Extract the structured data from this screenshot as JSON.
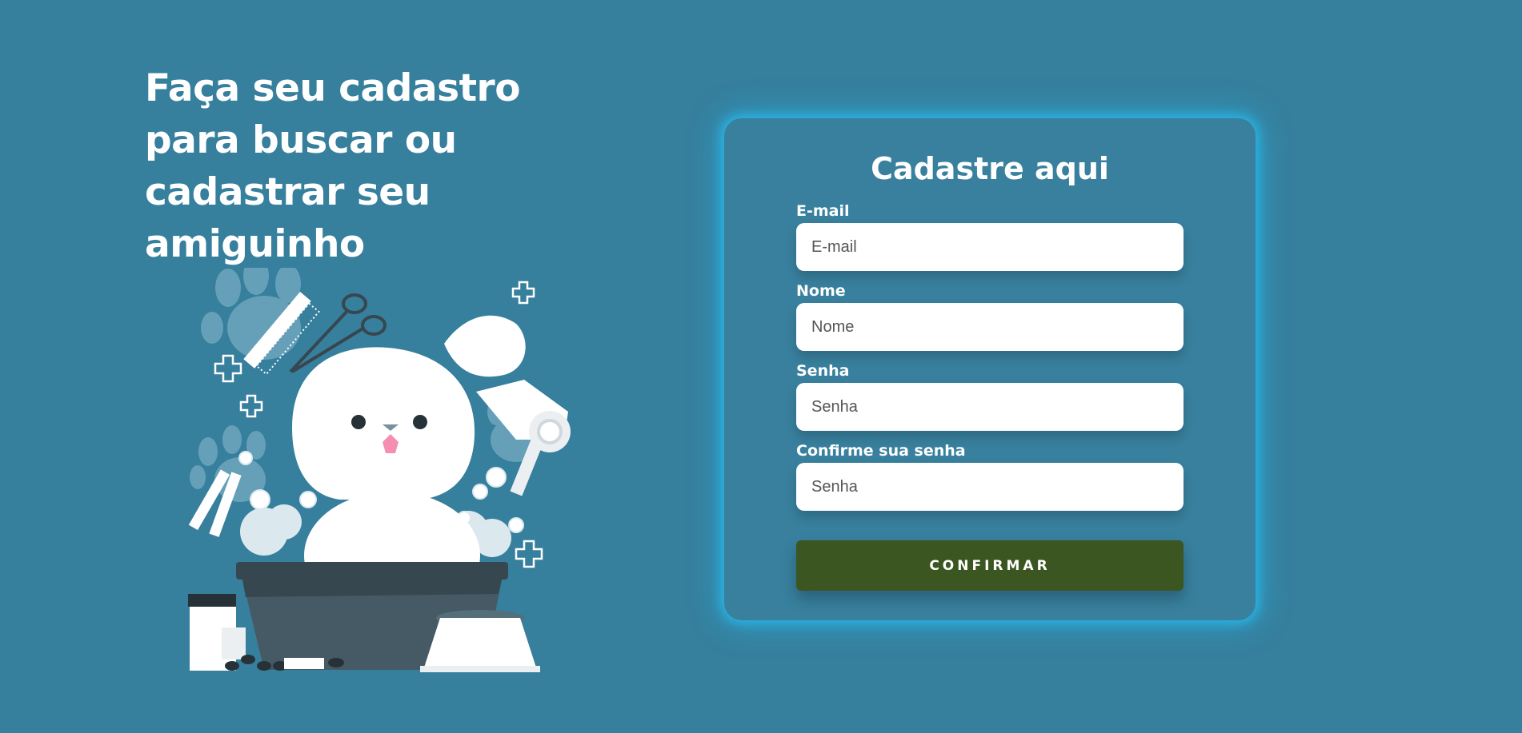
{
  "hero": {
    "headline": "Faça seu cadastro para buscar ou cadastrar seu amiguinho"
  },
  "form": {
    "title": "Cadastre aqui",
    "fields": [
      {
        "label": "E-mail",
        "placeholder": "E-mail",
        "value": ""
      },
      {
        "label": "Nome",
        "placeholder": "Nome",
        "value": ""
      },
      {
        "label": "Senha",
        "placeholder": "Senha",
        "value": ""
      },
      {
        "label": "Confirme sua senha",
        "placeholder": "Senha",
        "value": ""
      }
    ],
    "submit_label": "CONFIRMAR"
  },
  "icons": {
    "illustration": "dog-grooming-illustration"
  },
  "colors": {
    "background": "#367f9d",
    "card_glow": "#29b5e6",
    "button": "#3b5621",
    "text": "#ffffff"
  }
}
